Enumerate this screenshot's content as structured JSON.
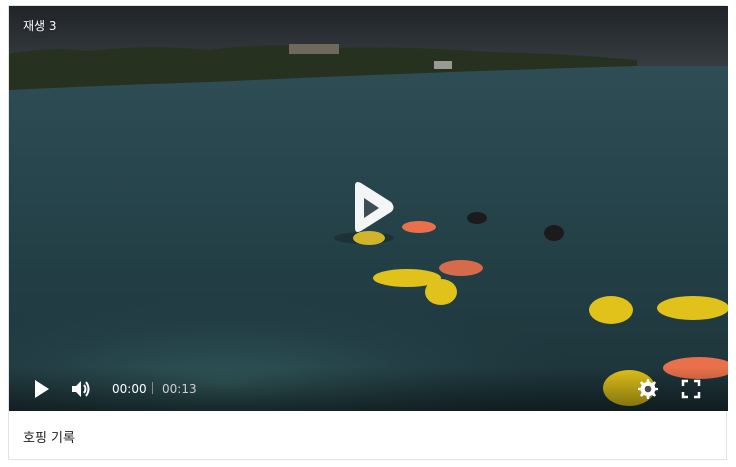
{
  "video": {
    "view_count": "재생 3",
    "current_time": "00:00",
    "duration": "00:13",
    "progress": 0
  },
  "caption": "호핑 기록",
  "icons": {
    "play": "play-icon",
    "volume": "volume-icon",
    "settings": "gear-icon",
    "fullscreen": "fullscreen-icon",
    "big_play": "big-play-icon"
  },
  "colors": {
    "water": "#28474c",
    "sky": "#2e3236",
    "shore": "#2c3a25",
    "vest": "#e0c21a",
    "ring": "#e9704a"
  }
}
